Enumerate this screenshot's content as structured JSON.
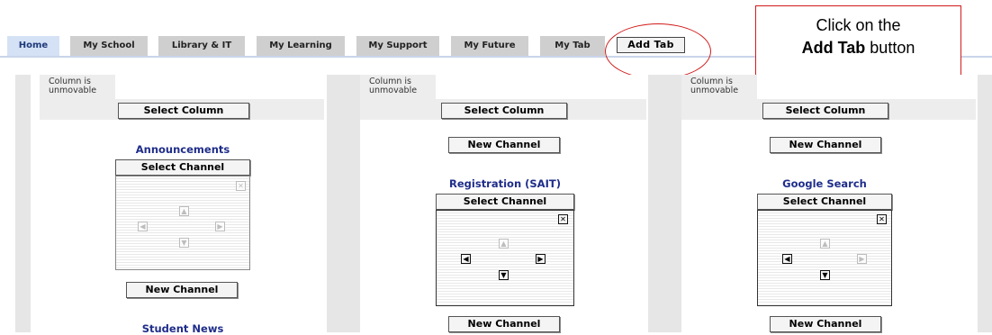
{
  "tabs": {
    "items": [
      {
        "label": "Home"
      },
      {
        "label": "My School"
      },
      {
        "label": "Library & IT"
      },
      {
        "label": "My Learning"
      },
      {
        "label": "My Support"
      },
      {
        "label": "My Future"
      },
      {
        "label": "My Tab"
      }
    ],
    "add_tab_label": "Add Tab"
  },
  "annotation": {
    "line1": "Click on the",
    "bold": "Add Tab",
    "line2_rest": " button"
  },
  "columns": [
    {
      "unmovable_line1": "Column is",
      "unmovable_line2": "unmovable",
      "select_column": "Select Column",
      "channels": [
        {
          "title": "Announcements",
          "select_channel": "Select Channel",
          "close": "✕"
        },
        {
          "new_channel": "New Channel"
        },
        {
          "title": "Student News"
        }
      ]
    },
    {
      "unmovable_line1": "Column is",
      "unmovable_line2": "unmovable",
      "select_column": "Select Column",
      "channels": [
        {
          "new_channel": "New Channel"
        },
        {
          "title": "Registration (SAIT)",
          "select_channel": "Select Channel",
          "close": "✕"
        },
        {
          "new_channel": "New Channel"
        }
      ]
    },
    {
      "unmovable_line1": "Column is",
      "unmovable_line2": "unmovable",
      "select_column": "Select Column",
      "channels": [
        {
          "new_channel": "New Channel"
        },
        {
          "title": "Google Search",
          "select_channel": "Select Channel",
          "close": "✕"
        },
        {
          "new_channel": "New Channel"
        }
      ]
    }
  ],
  "arrows": {
    "up": "▲",
    "down": "▼",
    "left": "◀",
    "right": "▶"
  },
  "colors": {
    "accent_red": "#d11b1b",
    "title_blue": "#1f2d8a",
    "active_tab": "#d5e2f5"
  }
}
